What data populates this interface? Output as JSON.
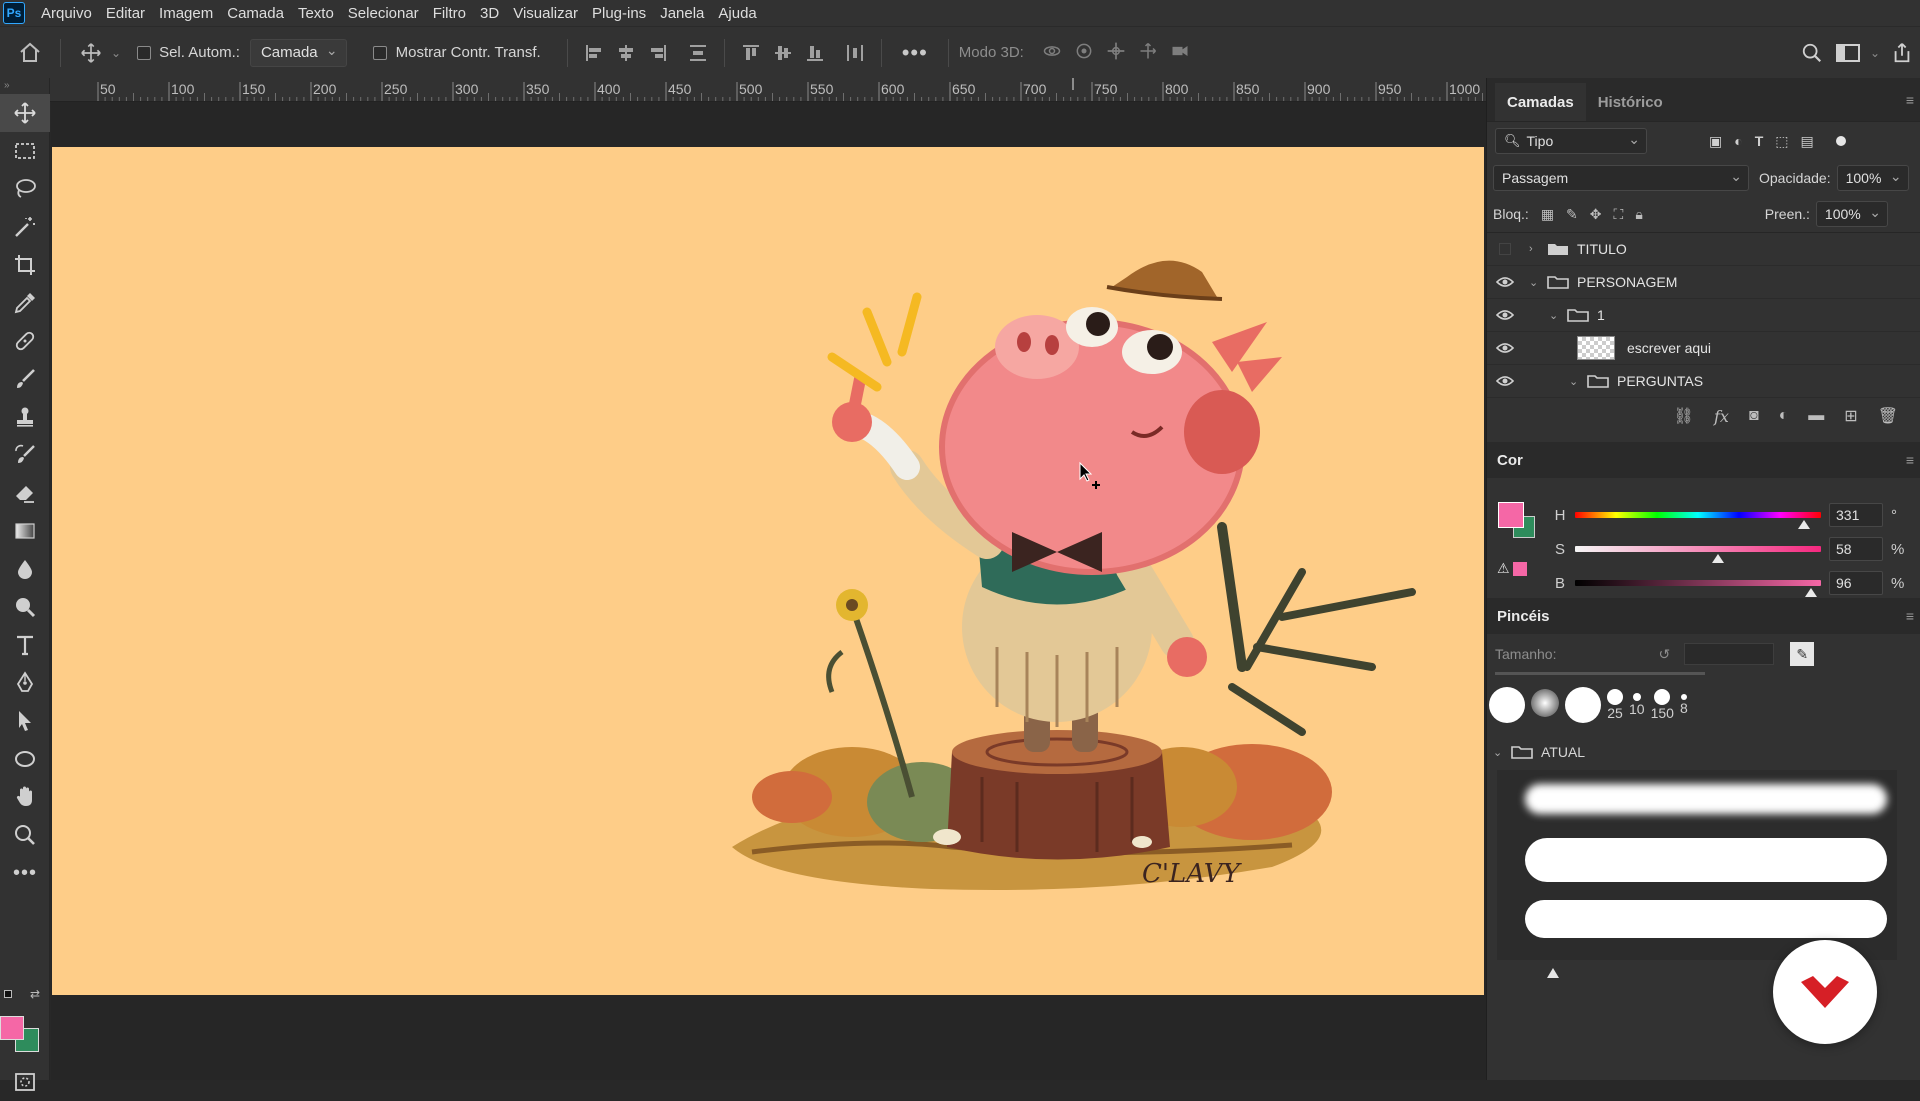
{
  "menubar": {
    "items": [
      "Arquivo",
      "Editar",
      "Imagem",
      "Camada",
      "Texto",
      "Selecionar",
      "Filtro",
      "3D",
      "Visualizar",
      "Plug-ins",
      "Janela",
      "Ajuda"
    ]
  },
  "options": {
    "auto_select_label": "Sel. Autom.:",
    "auto_select_value": "Camada",
    "transform_controls_label": "Mostrar Contr. Transf.",
    "mode3d_label": "Modo 3D:"
  },
  "ruler": {
    "labels": [
      "50",
      "100",
      "150",
      "200",
      "250",
      "300",
      "350",
      "400",
      "450",
      "500",
      "550",
      "600",
      "650",
      "700",
      "750",
      "800",
      "850",
      "900",
      "950",
      "1000"
    ]
  },
  "layers_panel": {
    "tabs": [
      "Camadas",
      "Histórico"
    ],
    "filter_value": "Tipo",
    "blend_mode": "Passagem",
    "opacity_label": "Opacidade:",
    "opacity_value": "100%",
    "lock_label": "Bloq.:",
    "fill_label": "Preen.:",
    "fill_value": "100%",
    "layers": [
      {
        "name": "TITULO",
        "visible": false,
        "type": "group",
        "expanded": false
      },
      {
        "name": "PERSONAGEM",
        "visible": true,
        "type": "group",
        "expanded": true
      },
      {
        "name": "1",
        "visible": true,
        "type": "group",
        "expanded": true
      },
      {
        "name": "escrever aqui",
        "visible": true,
        "type": "layer"
      },
      {
        "name": "PERGUNTAS",
        "visible": true,
        "type": "group",
        "expanded": true
      }
    ]
  },
  "color_panel": {
    "title": "Cor",
    "foreground": "#f567a6",
    "background": "#2e8c5c",
    "h_label": "H",
    "h_value": "331",
    "h_unit": "°",
    "s_label": "S",
    "s_value": "58",
    "s_unit": "%",
    "b_label": "B",
    "b_value": "96",
    "b_unit": "%"
  },
  "brushes_panel": {
    "title": "Pincéis",
    "size_label": "Tamanho:",
    "presets": [
      "",
      "",
      "",
      "25",
      "10",
      "150",
      "8"
    ],
    "group_name": "ATUAL"
  },
  "artwork": {
    "signature": "C'LAVY"
  }
}
